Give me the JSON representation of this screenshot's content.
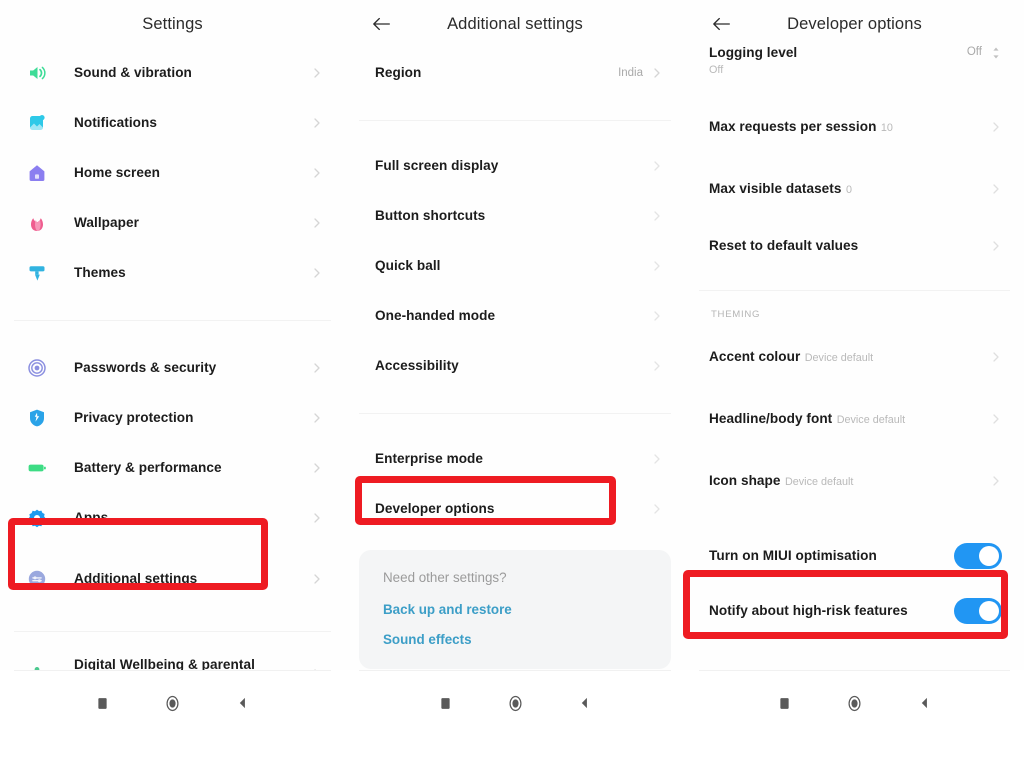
{
  "colors": {
    "highlight": "#ee1b22",
    "toggle_on": "#2196f3",
    "link": "#3c9ec7",
    "text_primary": "#1c1c1c",
    "text_secondary": "#b9b9b9"
  },
  "panel1": {
    "title": "Settings",
    "items": [
      {
        "label": "Sound & vibration",
        "icon": "speaker-icon",
        "icon_color": "#3ddc97",
        "chevron": true
      },
      {
        "label": "Notifications",
        "icon": "notification-bell-icon",
        "icon_color": "#2ec9e8",
        "chevron": true
      },
      {
        "label": "Home screen",
        "icon": "home-icon",
        "icon_color": "#8b7ef0",
        "chevron": true
      },
      {
        "label": "Wallpaper",
        "icon": "flower-icon",
        "icon_color": "#ef5d8f",
        "chevron": true
      },
      {
        "label": "Themes",
        "icon": "paint-roller-icon",
        "icon_color": "#31b3e0",
        "chevron": true
      },
      {
        "label": "Passwords & security",
        "icon": "fingerprint-icon",
        "icon_color": "#8b8fe0",
        "chevron": true
      },
      {
        "label": "Privacy protection",
        "icon": "shield-icon",
        "icon_color": "#2aa3e8",
        "chevron": true
      },
      {
        "label": "Battery & performance",
        "icon": "battery-icon",
        "icon_color": "#3ddc84",
        "chevron": true
      },
      {
        "label": "Apps",
        "icon": "gear-icon",
        "icon_color": "#1d9bf0",
        "chevron": true
      },
      {
        "label": "Additional settings",
        "icon": "sliders-icon",
        "icon_color": "#9aa8de",
        "chevron": true,
        "highlighted": true
      },
      {
        "label": "Digital Wellbeing & parental controls",
        "icon": "person-icon",
        "icon_color": "#4bc98f",
        "chevron": true
      }
    ]
  },
  "panel2": {
    "title": "Additional settings",
    "back_icon": "back-arrow-icon",
    "items": [
      {
        "label": "Region",
        "value": "India",
        "chevron": true
      },
      {
        "label": "Full screen display",
        "chevron": true
      },
      {
        "label": "Button shortcuts",
        "chevron": true
      },
      {
        "label": "Quick ball",
        "chevron": true
      },
      {
        "label": "One-handed mode",
        "chevron": true
      },
      {
        "label": "Accessibility",
        "chevron": true
      },
      {
        "label": "Enterprise mode",
        "chevron": true
      },
      {
        "label": "Developer options",
        "chevron": true,
        "highlighted": true
      }
    ],
    "help_card": {
      "question": "Need other settings?",
      "links": [
        "Back up and restore",
        "Sound effects"
      ]
    }
  },
  "panel3": {
    "title": "Developer options",
    "back_icon": "back-arrow-icon",
    "items": [
      {
        "label": "Logging level",
        "sub": "Off",
        "value": "Off",
        "control": "stepper",
        "clipped": true
      },
      {
        "label": "Max requests per session",
        "sub": "10",
        "chevron": true
      },
      {
        "label": "Max visible datasets",
        "sub": "0",
        "chevron": true
      },
      {
        "label": "Reset to default values",
        "chevron": true
      }
    ],
    "section_label": "THEMING",
    "theming_items": [
      {
        "label": "Accent colour",
        "sub": "Device default",
        "chevron": true
      },
      {
        "label": "Headline/body font",
        "sub": "Device default",
        "chevron": true
      },
      {
        "label": "Icon shape",
        "sub": "Device default",
        "chevron": true
      }
    ],
    "toggles": [
      {
        "label": "Turn on MIUI optimisation",
        "on": true,
        "highlighted": true
      },
      {
        "label": "Notify about high-risk features",
        "on": true
      }
    ]
  },
  "navbar": {
    "buttons": [
      "recents-square-icon",
      "home-circle-icon",
      "back-triangle-icon"
    ]
  }
}
